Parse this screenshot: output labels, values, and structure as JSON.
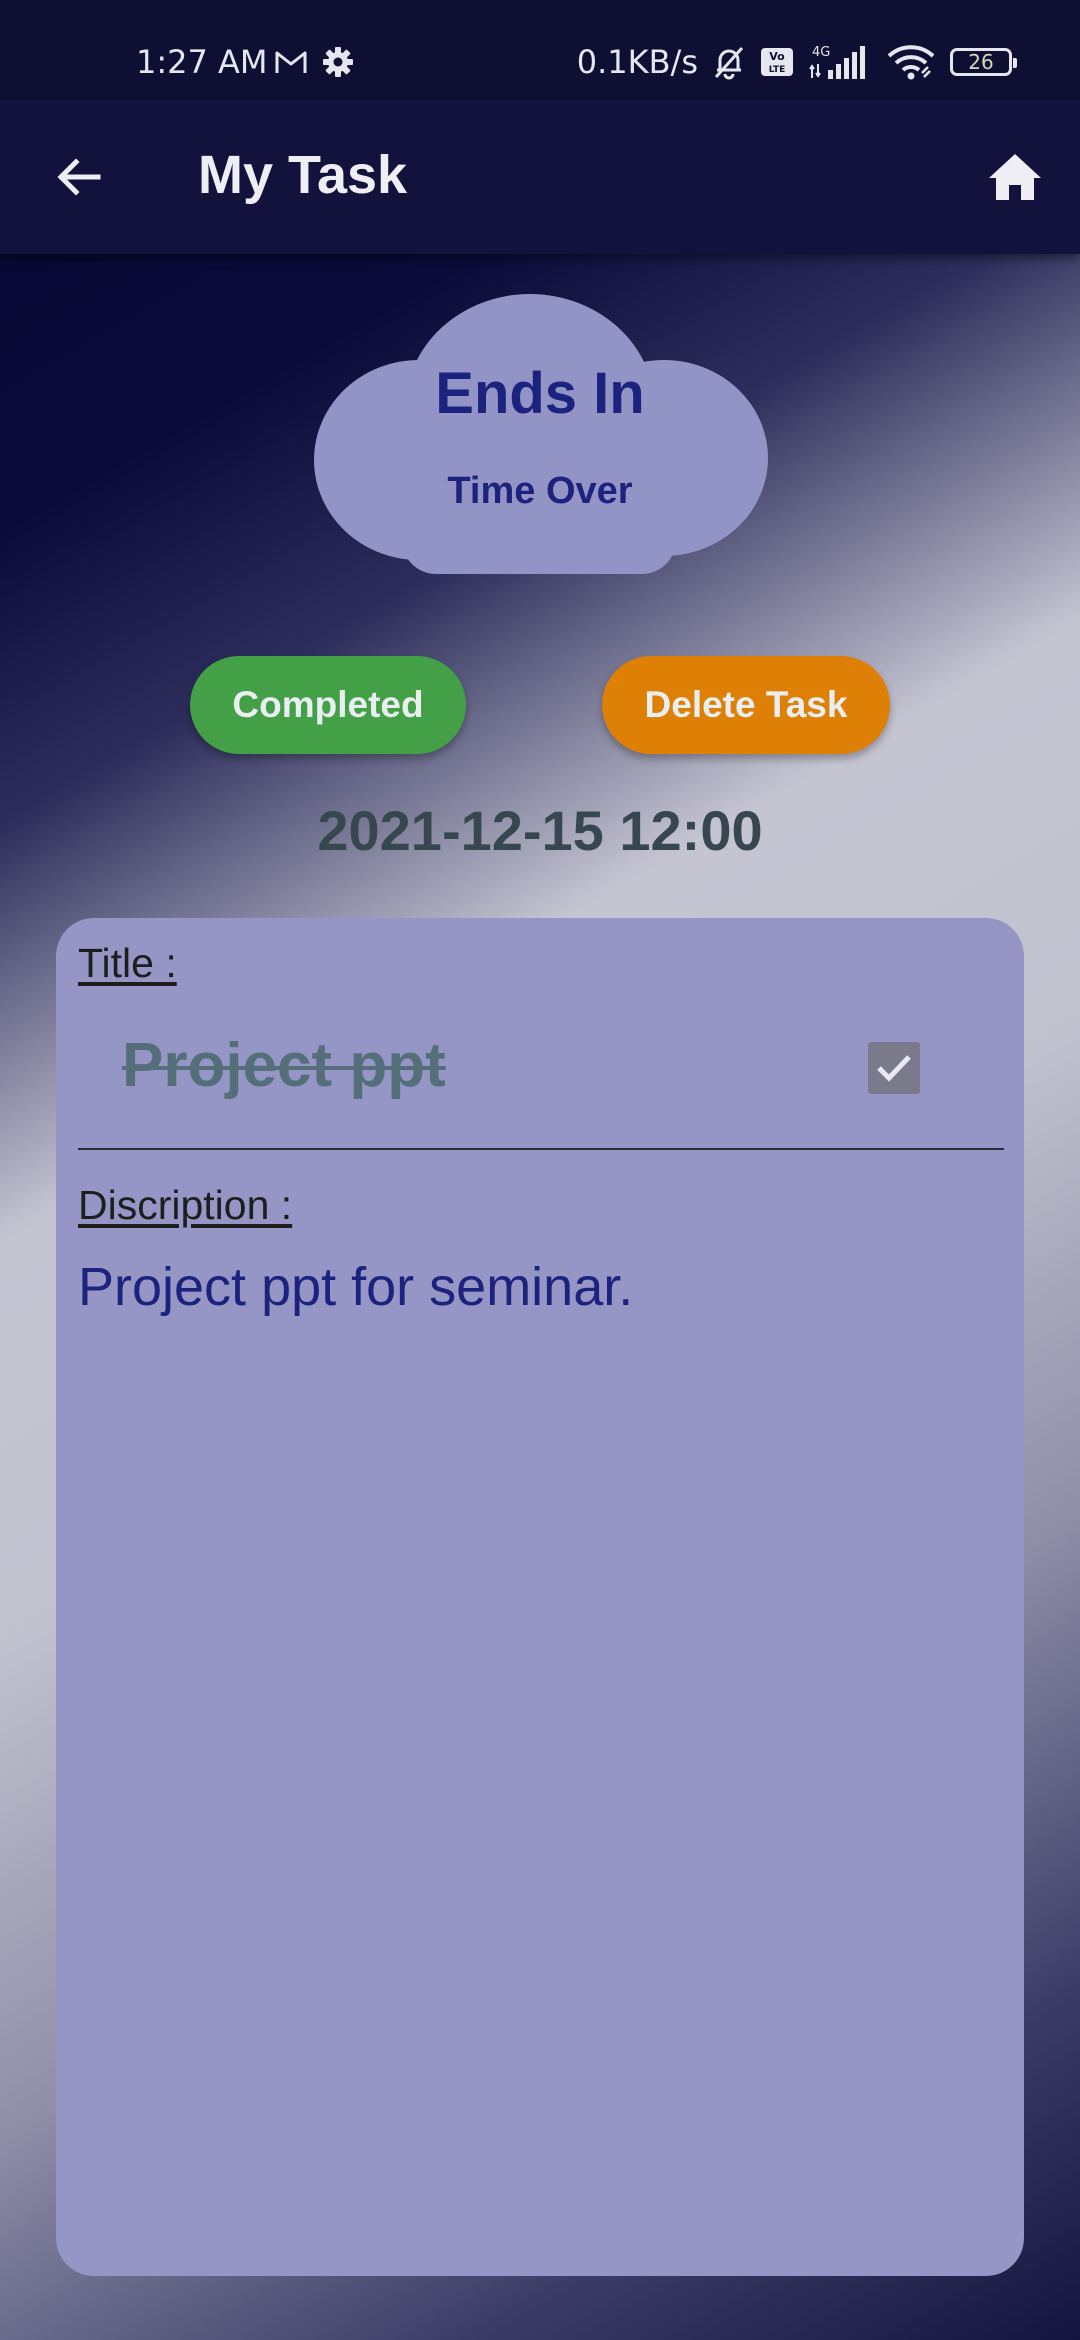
{
  "status_bar": {
    "time": "1:27 AM",
    "network_speed": "0.1KB/s",
    "network_type": "4G",
    "volte": "Vo LTE",
    "battery_level": "26",
    "icons": [
      "gmail-icon",
      "settings-icon",
      "mute-bell-icon",
      "volte-icon",
      "signal-icon",
      "wifi-icon",
      "battery-icon"
    ]
  },
  "app_bar": {
    "title": "My Task",
    "back_icon": "arrow-back-icon",
    "home_icon": "home-icon"
  },
  "countdown": {
    "heading": "Ends In",
    "status": "Time Over"
  },
  "actions": {
    "completed_label": "Completed",
    "delete_label": "Delete Task",
    "completed_color": "#43a047",
    "delete_color": "#dd8005"
  },
  "due_date": "2021-12-15 12:00",
  "task": {
    "title_label": "Title :",
    "title": "Project ppt",
    "completed": true,
    "description_label": "Discription :",
    "description": "Project ppt for seminar."
  },
  "colors": {
    "app_bar": "#12123c",
    "card": "#9596c6",
    "accent_text": "#1c237e"
  }
}
